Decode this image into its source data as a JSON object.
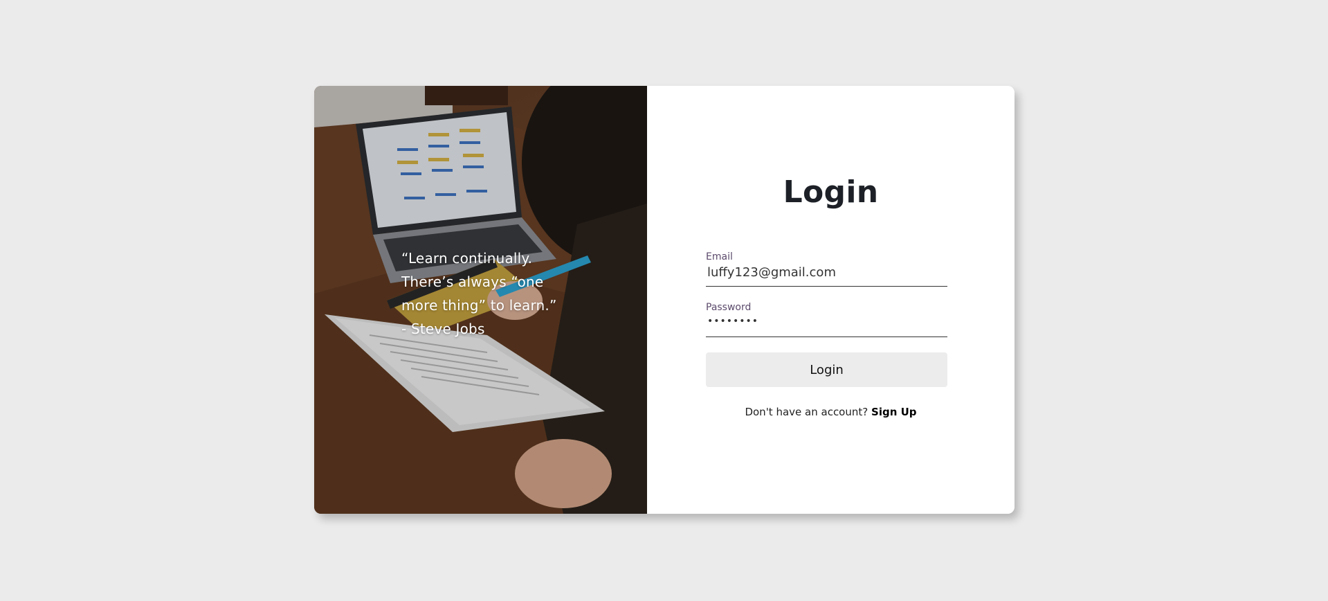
{
  "photo": {
    "quote_lines": [
      "“Learn continually.",
      "There’s always “one",
      "more thing” to learn.”",
      "- Steve Jobs"
    ]
  },
  "login": {
    "title": "Login",
    "email_label": "Email",
    "email_value": "luffy123@gmail.com",
    "password_label": "Password",
    "password_value": "••••••••",
    "button_label": "Login",
    "signup_prompt": "Don't have an account?",
    "signup_link": "Sign Up"
  },
  "colors": {
    "background": "#ebebeb",
    "card": "#ffffff",
    "button": "#ececec",
    "title": "#1d2127"
  }
}
